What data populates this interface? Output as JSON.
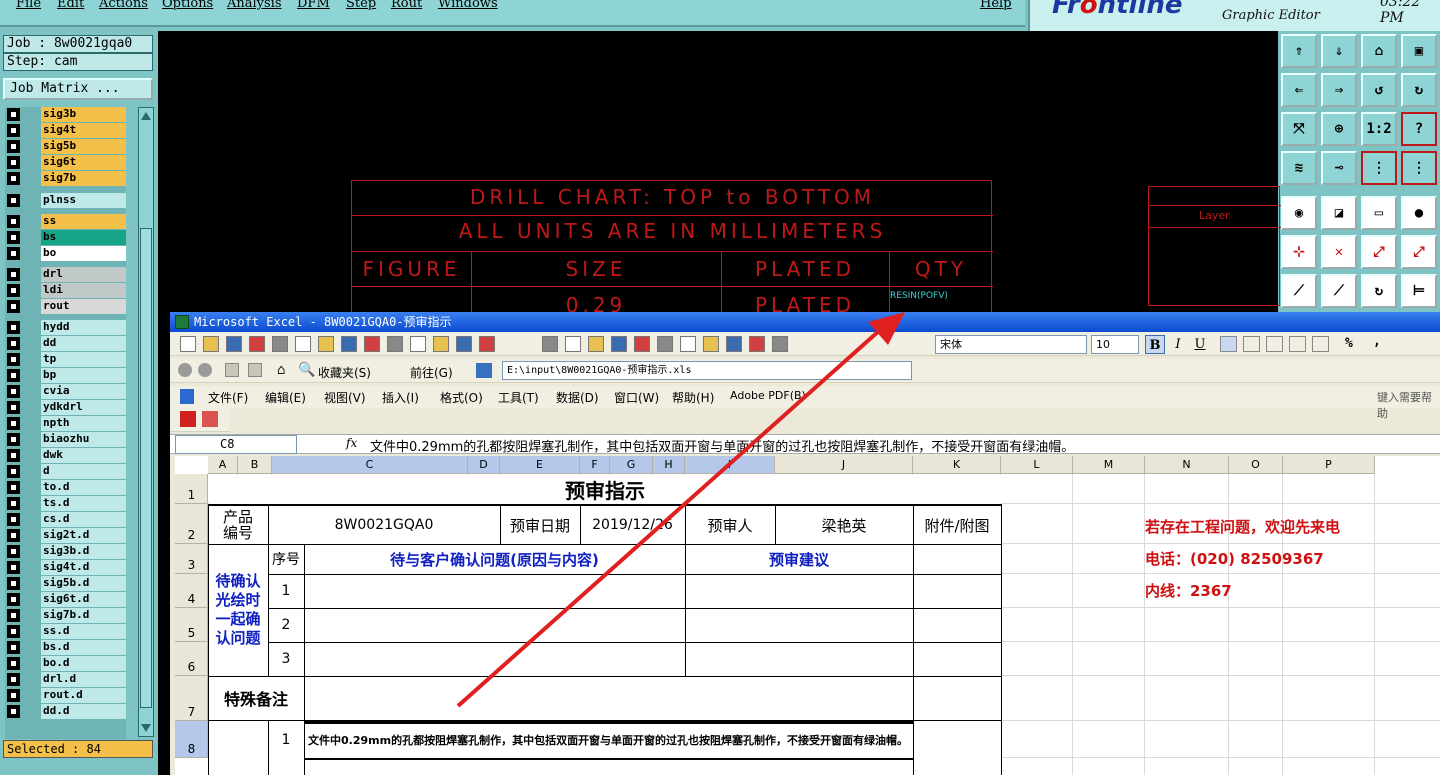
{
  "menubar": {
    "items": [
      "File",
      "Edit",
      "Actions",
      "Options",
      "Analysis",
      "DFM",
      "Step",
      "Rout",
      "Windows"
    ],
    "help": "Help"
  },
  "logo": {
    "brand_a": "Fr",
    "brand_o": "o",
    "brand_b": "ntline",
    "product": "Graphic Editor",
    "clock": "03:22 PM"
  },
  "leftpanel": {
    "job": "Job : 8w0021gqa0",
    "step": "Step: cam",
    "job_matrix": "Job Matrix ...",
    "selected": "Selected : 84",
    "layers": [
      {
        "name": "sig3b",
        "color": "sig"
      },
      {
        "name": "sig4t",
        "color": "sig"
      },
      {
        "name": "sig5b",
        "color": "sig"
      },
      {
        "name": "sig6t",
        "color": "sig"
      },
      {
        "name": "sig7b",
        "color": "sig"
      },
      {
        "name": "plnss",
        "color": "teal"
      },
      {
        "name": "ss",
        "color": "sig"
      },
      {
        "name": "bs",
        "color": "green"
      },
      {
        "name": "bo",
        "color": "white"
      },
      {
        "name": "drl",
        "color": "gray"
      },
      {
        "name": "ldi",
        "color": "gray"
      },
      {
        "name": "rout",
        "color": "lgray"
      },
      {
        "name": "hydd",
        "color": "teal"
      },
      {
        "name": "dd",
        "color": "teal"
      },
      {
        "name": "tp",
        "color": "teal"
      },
      {
        "name": "bp",
        "color": "teal"
      },
      {
        "name": "cvia",
        "color": "teal"
      },
      {
        "name": "ydkdrl",
        "color": "teal"
      },
      {
        "name": "npth",
        "color": "teal"
      },
      {
        "name": "biaozhu",
        "color": "teal"
      },
      {
        "name": "dwk",
        "color": "teal"
      },
      {
        "name": "d",
        "color": "teal"
      },
      {
        "name": "to.d",
        "color": "teal"
      },
      {
        "name": "ts.d",
        "color": "teal"
      },
      {
        "name": "cs.d",
        "color": "teal"
      },
      {
        "name": "sig2t.d",
        "color": "teal"
      },
      {
        "name": "sig3b.d",
        "color": "teal"
      },
      {
        "name": "sig4t.d",
        "color": "teal"
      },
      {
        "name": "sig5b.d",
        "color": "teal"
      },
      {
        "name": "sig6t.d",
        "color": "teal"
      },
      {
        "name": "sig7b.d",
        "color": "teal"
      },
      {
        "name": "ss.d",
        "color": "teal"
      },
      {
        "name": "bs.d",
        "color": "teal"
      },
      {
        "name": "bo.d",
        "color": "teal"
      },
      {
        "name": "drl.d",
        "color": "teal"
      },
      {
        "name": "rout.d",
        "color": "teal"
      },
      {
        "name": "dd.d",
        "color": "teal"
      }
    ]
  },
  "iconpanel": {
    "buttons": [
      "up-page",
      "down-page",
      "home",
      "window",
      "left-page",
      "right-page",
      "undo-page",
      "redo-page",
      "fit",
      "center",
      "1:2",
      "?",
      "settings",
      "measure",
      "snap-a",
      "snap-b",
      "new-feature",
      "edit-feature",
      "ruler",
      "stop",
      "net-a",
      "net-b",
      "net-c",
      "net-d",
      "line-a",
      "line-b",
      "rotate",
      "mirror"
    ]
  },
  "drill": {
    "title1": "DRILL CHART: TOP to BOTTOM",
    "title2": "ALL UNITS ARE IN MILLIMETERS",
    "col_figure": "FIGURE",
    "col_size": "SIZE",
    "col_plated": "PLATED",
    "col_qty": "QTY",
    "row_size": "0.29",
    "row_plated": "PLATED",
    "resin": "RESIN(POFV)",
    "layer_label": "Layer"
  },
  "excel": {
    "title": "Microsoft Excel - 8W0021GQA0-预审指示",
    "address": "E:\\input\\8W0021GQA0-预审指示.xls",
    "favorites": "收藏夹(S)",
    "goto": "前往(G)",
    "font": "宋体",
    "size": "10",
    "b": "B",
    "i": "I",
    "u": "U",
    "percent": "%",
    "comma": ",",
    "help_hint": "键入需要帮助",
    "menus": [
      "文件(F)",
      "编辑(E)",
      "视图(V)",
      "插入(I)",
      "格式(O)",
      "工具(T)",
      "数据(D)",
      "窗口(W)",
      "帮助(H)",
      "Adobe PDF(B)"
    ],
    "namebox": "C8",
    "fx": "fx",
    "formula": "文件中0.29mm的孔都按阻焊塞孔制作，其中包括双面开窗与单面开窗的过孔也按阻焊塞孔制作，不接受开窗面有绿油帽。",
    "columns": [
      "A",
      "B",
      "C",
      "D",
      "E",
      "F",
      "G",
      "H",
      "I",
      "J",
      "K",
      "L",
      "M",
      "N",
      "O",
      "P"
    ],
    "rows": [
      "1",
      "2",
      "3",
      "4",
      "5",
      "6",
      "7",
      "8"
    ],
    "sheet": {
      "title": "预审指示",
      "product_label": "产品编号",
      "product_no": "8W0021GQA0",
      "date_label": "预审日期",
      "date": "2019/12/26",
      "reviewer_label": "预审人",
      "reviewer": "梁艳英",
      "attach_label": "附件/附图",
      "pending_label": "待确认光绘时一起确认问题",
      "seq_label": "序号",
      "question_label": "待与客户确认问题(原因与内容)",
      "suggest_label": "预审建议",
      "seq": [
        "1",
        "2",
        "3"
      ],
      "remark_label": "特殊备注",
      "remark_seq": "1",
      "remark_text": "文件中0.29mm的孔都按阻焊塞孔制作，其中包括双面开窗与单面开窗的过孔也按阻焊塞孔制作，不接受开窗面有绿油帽。",
      "contact1": "若存在工程问题，欢迎先来电",
      "contact2": "电话：(020) 82509367",
      "contact3": "内线：2367"
    }
  },
  "colors": {
    "accent_red": "#e02020",
    "genesis_teal": "#7fc4c4",
    "layer_orange": "#f5c04a"
  }
}
